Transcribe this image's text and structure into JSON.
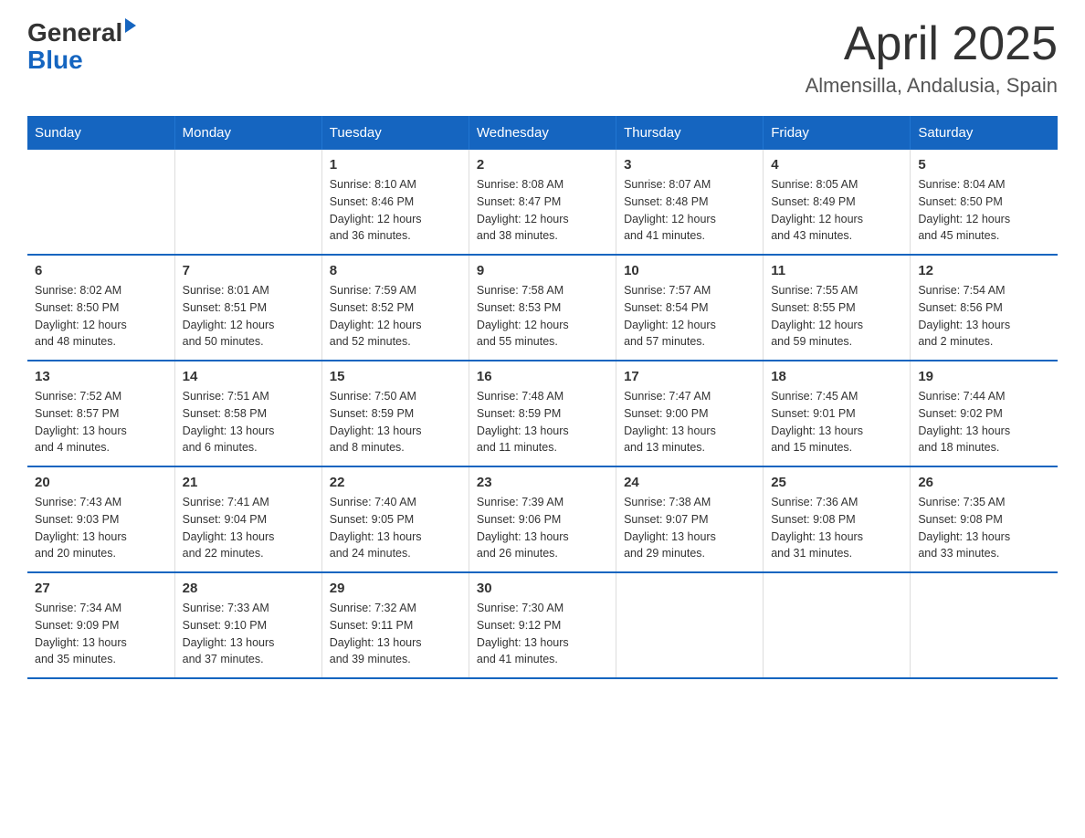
{
  "header": {
    "logo_general": "General",
    "logo_blue": "Blue",
    "title": "April 2025",
    "subtitle": "Almensilla, Andalusia, Spain"
  },
  "weekdays": [
    "Sunday",
    "Monday",
    "Tuesday",
    "Wednesday",
    "Thursday",
    "Friday",
    "Saturday"
  ],
  "weeks": [
    [
      {
        "day": "",
        "info": ""
      },
      {
        "day": "",
        "info": ""
      },
      {
        "day": "1",
        "info": "Sunrise: 8:10 AM\nSunset: 8:46 PM\nDaylight: 12 hours\nand 36 minutes."
      },
      {
        "day": "2",
        "info": "Sunrise: 8:08 AM\nSunset: 8:47 PM\nDaylight: 12 hours\nand 38 minutes."
      },
      {
        "day": "3",
        "info": "Sunrise: 8:07 AM\nSunset: 8:48 PM\nDaylight: 12 hours\nand 41 minutes."
      },
      {
        "day": "4",
        "info": "Sunrise: 8:05 AM\nSunset: 8:49 PM\nDaylight: 12 hours\nand 43 minutes."
      },
      {
        "day": "5",
        "info": "Sunrise: 8:04 AM\nSunset: 8:50 PM\nDaylight: 12 hours\nand 45 minutes."
      }
    ],
    [
      {
        "day": "6",
        "info": "Sunrise: 8:02 AM\nSunset: 8:50 PM\nDaylight: 12 hours\nand 48 minutes."
      },
      {
        "day": "7",
        "info": "Sunrise: 8:01 AM\nSunset: 8:51 PM\nDaylight: 12 hours\nand 50 minutes."
      },
      {
        "day": "8",
        "info": "Sunrise: 7:59 AM\nSunset: 8:52 PM\nDaylight: 12 hours\nand 52 minutes."
      },
      {
        "day": "9",
        "info": "Sunrise: 7:58 AM\nSunset: 8:53 PM\nDaylight: 12 hours\nand 55 minutes."
      },
      {
        "day": "10",
        "info": "Sunrise: 7:57 AM\nSunset: 8:54 PM\nDaylight: 12 hours\nand 57 minutes."
      },
      {
        "day": "11",
        "info": "Sunrise: 7:55 AM\nSunset: 8:55 PM\nDaylight: 12 hours\nand 59 minutes."
      },
      {
        "day": "12",
        "info": "Sunrise: 7:54 AM\nSunset: 8:56 PM\nDaylight: 13 hours\nand 2 minutes."
      }
    ],
    [
      {
        "day": "13",
        "info": "Sunrise: 7:52 AM\nSunset: 8:57 PM\nDaylight: 13 hours\nand 4 minutes."
      },
      {
        "day": "14",
        "info": "Sunrise: 7:51 AM\nSunset: 8:58 PM\nDaylight: 13 hours\nand 6 minutes."
      },
      {
        "day": "15",
        "info": "Sunrise: 7:50 AM\nSunset: 8:59 PM\nDaylight: 13 hours\nand 8 minutes."
      },
      {
        "day": "16",
        "info": "Sunrise: 7:48 AM\nSunset: 8:59 PM\nDaylight: 13 hours\nand 11 minutes."
      },
      {
        "day": "17",
        "info": "Sunrise: 7:47 AM\nSunset: 9:00 PM\nDaylight: 13 hours\nand 13 minutes."
      },
      {
        "day": "18",
        "info": "Sunrise: 7:45 AM\nSunset: 9:01 PM\nDaylight: 13 hours\nand 15 minutes."
      },
      {
        "day": "19",
        "info": "Sunrise: 7:44 AM\nSunset: 9:02 PM\nDaylight: 13 hours\nand 18 minutes."
      }
    ],
    [
      {
        "day": "20",
        "info": "Sunrise: 7:43 AM\nSunset: 9:03 PM\nDaylight: 13 hours\nand 20 minutes."
      },
      {
        "day": "21",
        "info": "Sunrise: 7:41 AM\nSunset: 9:04 PM\nDaylight: 13 hours\nand 22 minutes."
      },
      {
        "day": "22",
        "info": "Sunrise: 7:40 AM\nSunset: 9:05 PM\nDaylight: 13 hours\nand 24 minutes."
      },
      {
        "day": "23",
        "info": "Sunrise: 7:39 AM\nSunset: 9:06 PM\nDaylight: 13 hours\nand 26 minutes."
      },
      {
        "day": "24",
        "info": "Sunrise: 7:38 AM\nSunset: 9:07 PM\nDaylight: 13 hours\nand 29 minutes."
      },
      {
        "day": "25",
        "info": "Sunrise: 7:36 AM\nSunset: 9:08 PM\nDaylight: 13 hours\nand 31 minutes."
      },
      {
        "day": "26",
        "info": "Sunrise: 7:35 AM\nSunset: 9:08 PM\nDaylight: 13 hours\nand 33 minutes."
      }
    ],
    [
      {
        "day": "27",
        "info": "Sunrise: 7:34 AM\nSunset: 9:09 PM\nDaylight: 13 hours\nand 35 minutes."
      },
      {
        "day": "28",
        "info": "Sunrise: 7:33 AM\nSunset: 9:10 PM\nDaylight: 13 hours\nand 37 minutes."
      },
      {
        "day": "29",
        "info": "Sunrise: 7:32 AM\nSunset: 9:11 PM\nDaylight: 13 hours\nand 39 minutes."
      },
      {
        "day": "30",
        "info": "Sunrise: 7:30 AM\nSunset: 9:12 PM\nDaylight: 13 hours\nand 41 minutes."
      },
      {
        "day": "",
        "info": ""
      },
      {
        "day": "",
        "info": ""
      },
      {
        "day": "",
        "info": ""
      }
    ]
  ]
}
